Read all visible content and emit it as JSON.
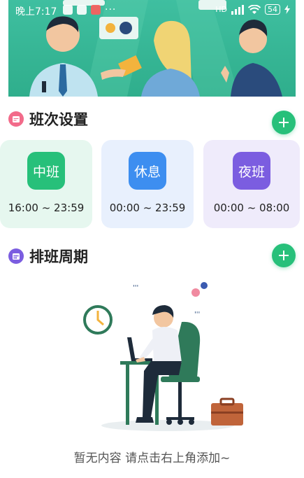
{
  "status_bar": {
    "time": "晚上7:17",
    "more": "···",
    "network": "HD",
    "battery": "54"
  },
  "shift_section": {
    "title": "班次设置",
    "add_icon": "plus-icon",
    "cards": [
      {
        "label": "中班",
        "time": "16:00 ~ 23:59",
        "color": "#27c07a",
        "bg": "#e6f7ef"
      },
      {
        "label": "休息",
        "time": "00:00 ~ 23:59",
        "color": "#3d8ef0",
        "bg": "#e8f0fd"
      },
      {
        "label": "夜班",
        "time": "00:00 ~ 08:00",
        "color": "#7b5de0",
        "bg": "#efebfb"
      }
    ]
  },
  "cycle_section": {
    "title": "排班周期",
    "add_icon": "plus-icon"
  },
  "empty_state": {
    "message": "暂无内容 请点击右上角添加~"
  },
  "colors": {
    "accent": "#27c07a",
    "banner": "#35b894",
    "shift_icon": "#f26b8a",
    "cycle_icon": "#7b5de0"
  }
}
